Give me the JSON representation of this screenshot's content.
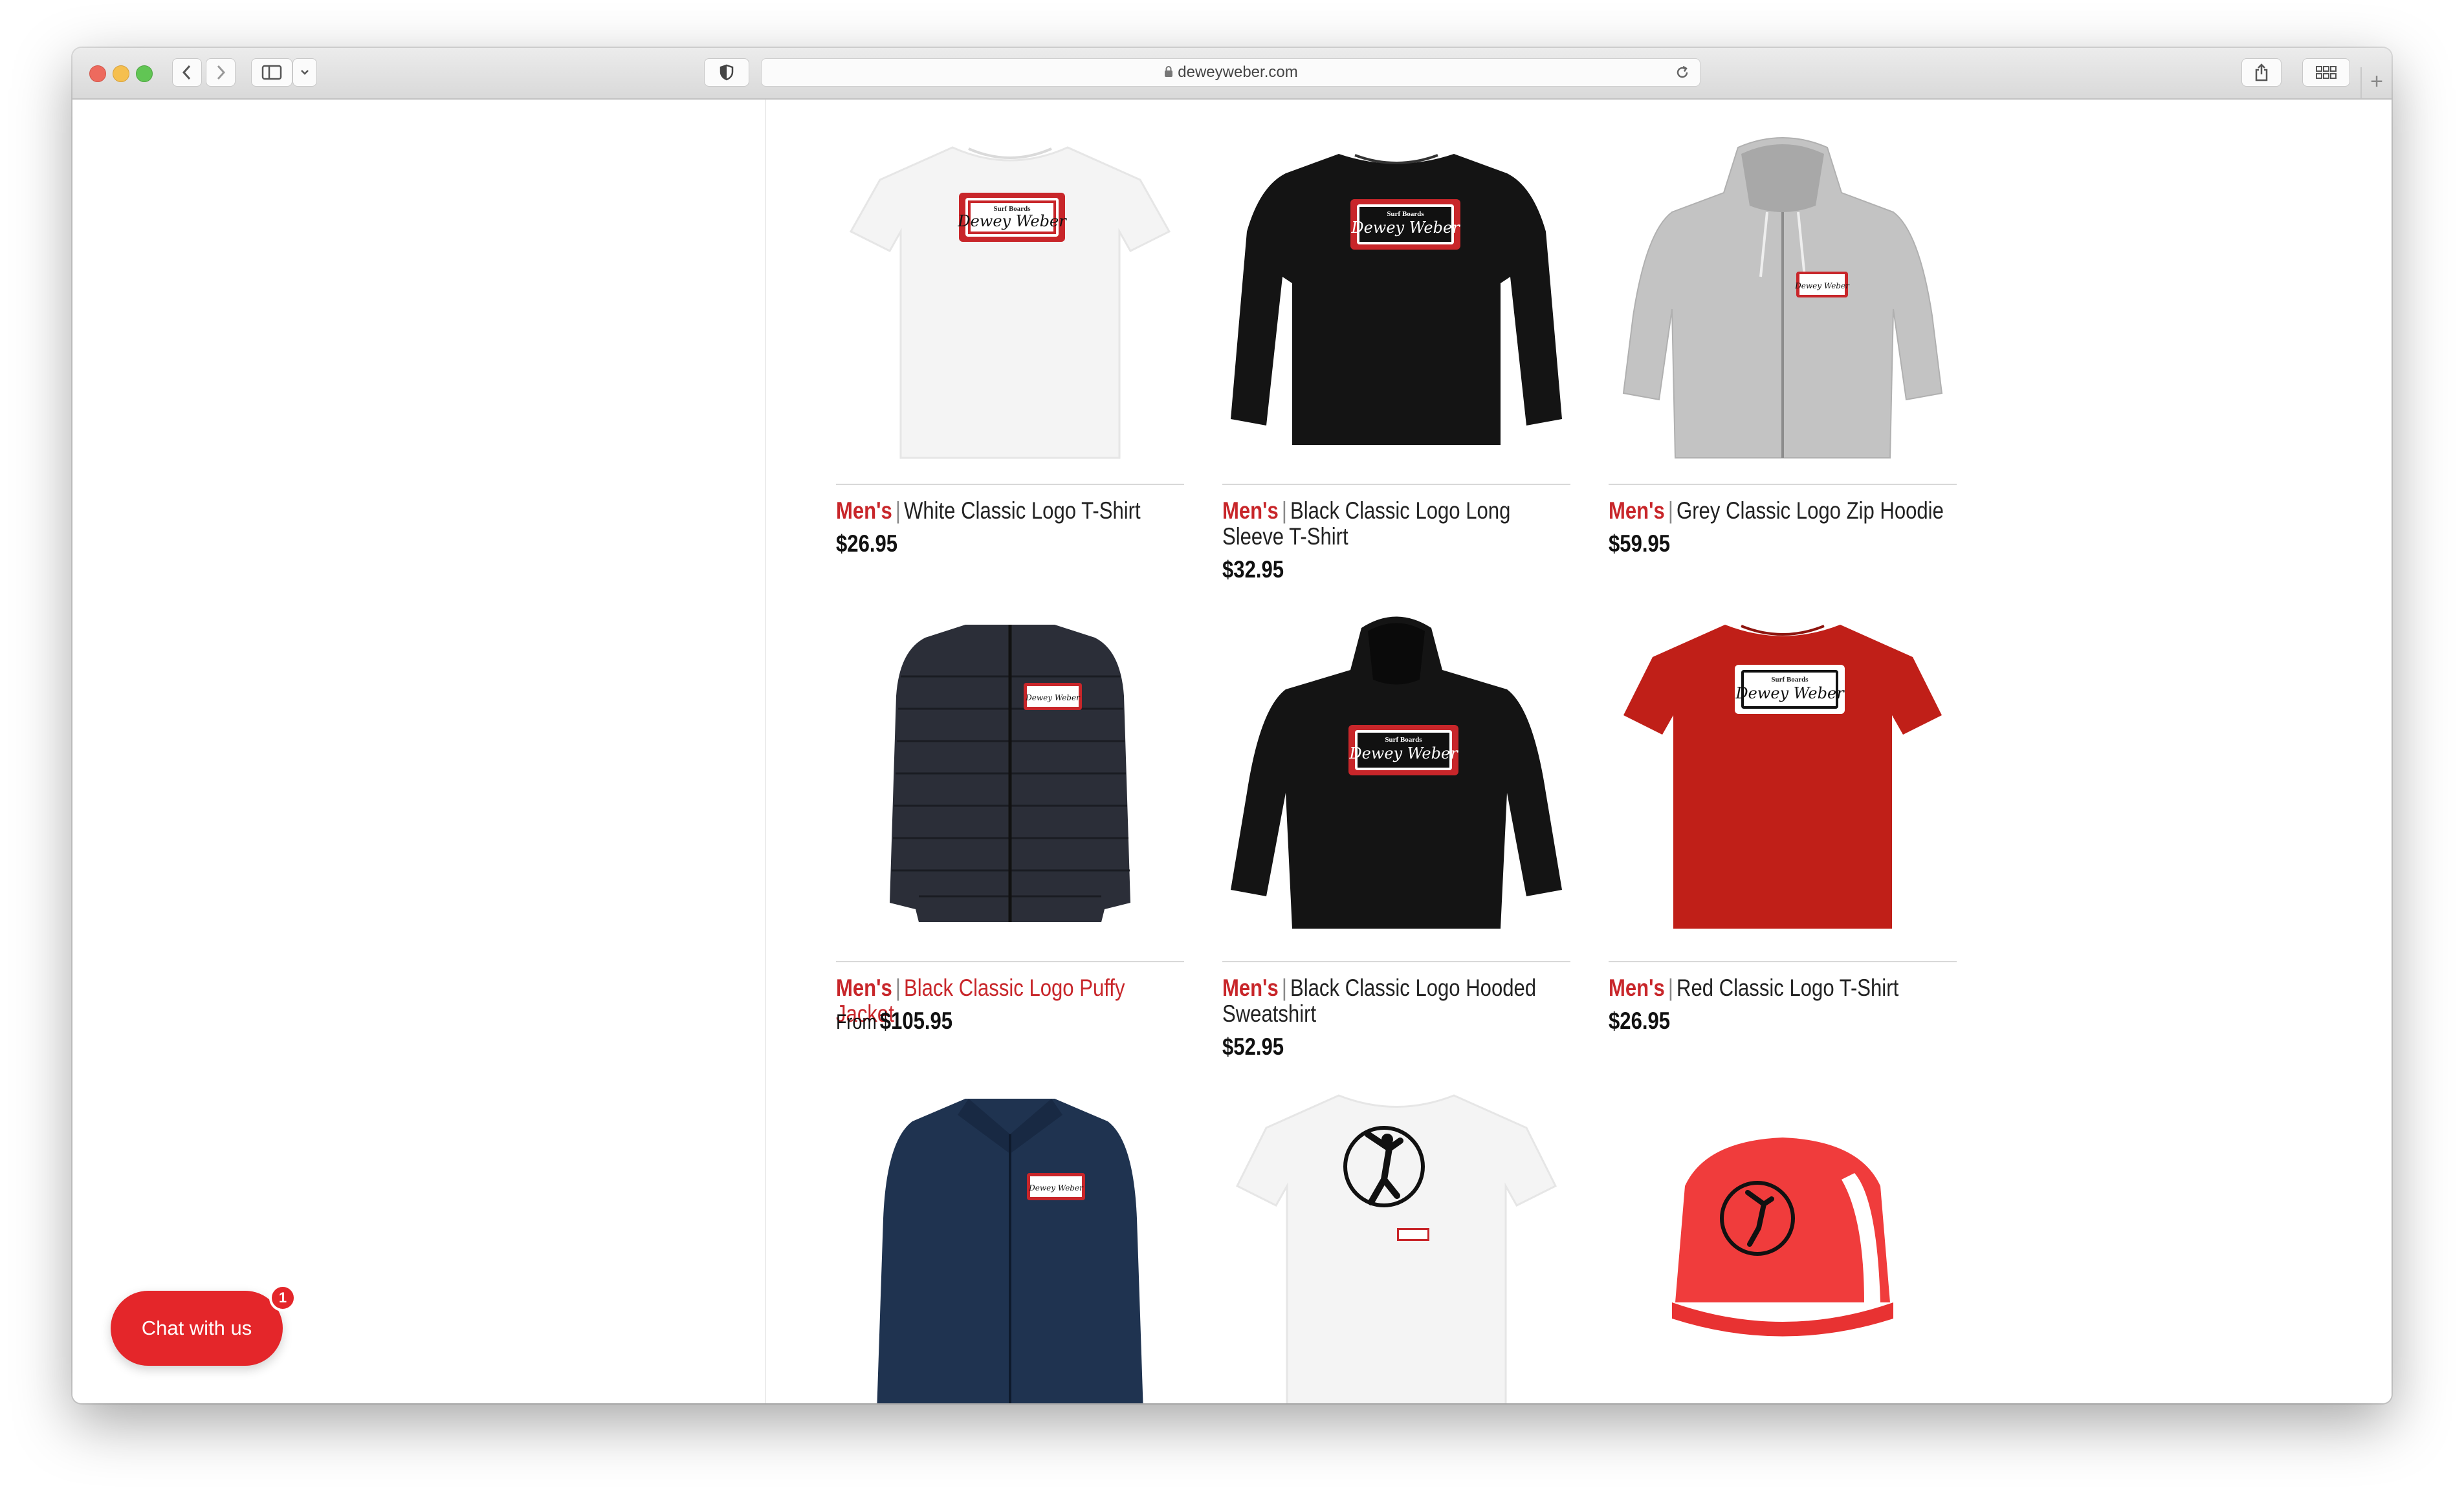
{
  "browser": {
    "url": "deweyweber.com",
    "new_tab_label": "+"
  },
  "products": [
    {
      "category": "Men's",
      "name": "White Classic Logo T-Shirt",
      "price": "$26.95",
      "price_prefix": "",
      "name_highlighted": false
    },
    {
      "category": "Men's",
      "name": "Black Classic Logo Long Sleeve T-Shirt",
      "price": "$32.95",
      "price_prefix": "",
      "name_highlighted": false
    },
    {
      "category": "Men's",
      "name": "Grey Classic Logo Zip Hoodie",
      "price": "$59.95",
      "price_prefix": "",
      "name_highlighted": false
    },
    {
      "category": "Men's",
      "name": "Black Classic Logo Puffy Jacket",
      "price": "$105.95",
      "price_prefix": "From",
      "name_highlighted": true
    },
    {
      "category": "Men's",
      "name": "Black Classic Logo Hooded Sweatshirt",
      "price": "$52.95",
      "price_prefix": "",
      "name_highlighted": false
    },
    {
      "category": "Men's",
      "name": "Red Classic Logo T-Shirt",
      "price": "$26.95",
      "price_prefix": "",
      "name_highlighted": false
    }
  ],
  "separator": "|",
  "logo_text": {
    "top": "Surf Boards",
    "main": "Dewey Weber"
  },
  "chat": {
    "label": "Chat with us",
    "badge_count": "1"
  },
  "colors": {
    "accent": "#c8262a",
    "chat": "#e4262a"
  },
  "icons": [
    "back-icon",
    "forward-icon",
    "sidebar-icon",
    "chevron-down-icon",
    "privacy-shield-icon",
    "lock-icon",
    "reload-icon",
    "share-icon",
    "tab-overview-icon"
  ]
}
